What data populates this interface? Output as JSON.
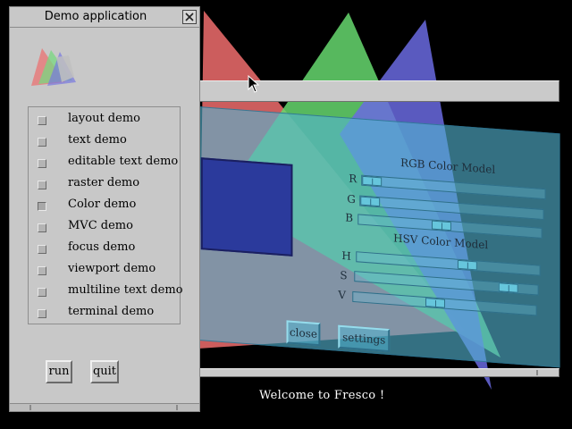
{
  "window": {
    "title": "Demo application"
  },
  "demos": [
    {
      "label": "layout demo",
      "checked": false
    },
    {
      "label": "text demo",
      "checked": false
    },
    {
      "label": "editable text demo",
      "checked": false
    },
    {
      "label": "raster demo",
      "checked": false
    },
    {
      "label": "Color demo",
      "checked": true
    },
    {
      "label": "MVC demo",
      "checked": false
    },
    {
      "label": "focus demo",
      "checked": false
    },
    {
      "label": "viewport demo",
      "checked": false
    },
    {
      "label": "multiline text demo",
      "checked": false
    },
    {
      "label": "terminal demo",
      "checked": false
    }
  ],
  "buttons": {
    "run": "run",
    "quit": "quit"
  },
  "status": {
    "welcome": "Welcome to Fresco !"
  },
  "color_demo": {
    "rgb_title": "RGB Color Model",
    "hsv_title": "HSV Color Model",
    "swatch_color": "#2b3a9c",
    "rgb": [
      {
        "label": "R",
        "value": 0.0
      },
      {
        "label": "G",
        "value": 0.0
      },
      {
        "label": "B",
        "value": 0.45
      }
    ],
    "hsv": [
      {
        "label": "H",
        "value": 0.62
      },
      {
        "label": "S",
        "value": 0.88
      },
      {
        "label": "V",
        "value": 0.44
      }
    ],
    "close_label": "close",
    "settings_label": "settings"
  },
  "background": {
    "triangle_colors": [
      "#e86a6a",
      "#66d86e",
      "#6a6ae0"
    ]
  },
  "icons": {
    "logo": "fresco-logo-icon",
    "close": "close-icon",
    "cursor": "mouse-pointer-icon"
  }
}
